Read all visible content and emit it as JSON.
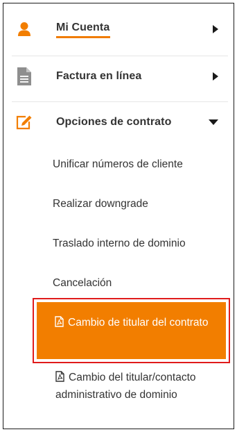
{
  "colors": {
    "accent": "#f27e00",
    "highlight_border": "#e01b1b",
    "text": "#333333"
  },
  "menu": {
    "items": [
      {
        "label": "Mi Cuenta",
        "icon": "user-icon",
        "arrow": "caret-right-icon"
      },
      {
        "label": "Factura en línea",
        "icon": "document-icon",
        "arrow": "caret-right-icon"
      },
      {
        "label": "Opciones de contrato",
        "icon": "edit-icon",
        "arrow": "caret-down-icon"
      }
    ],
    "subitems": [
      "Unificar números de cliente",
      "Realizar downgrade",
      "Traslado interno de dominio",
      "Cancelación"
    ],
    "active_item": {
      "label": "Cambio de titular del contrato",
      "icon": "pdf-icon"
    },
    "doc_item": {
      "label": "Cambio del titular/contacto administrativo de dominio",
      "icon": "pdf-icon"
    }
  }
}
